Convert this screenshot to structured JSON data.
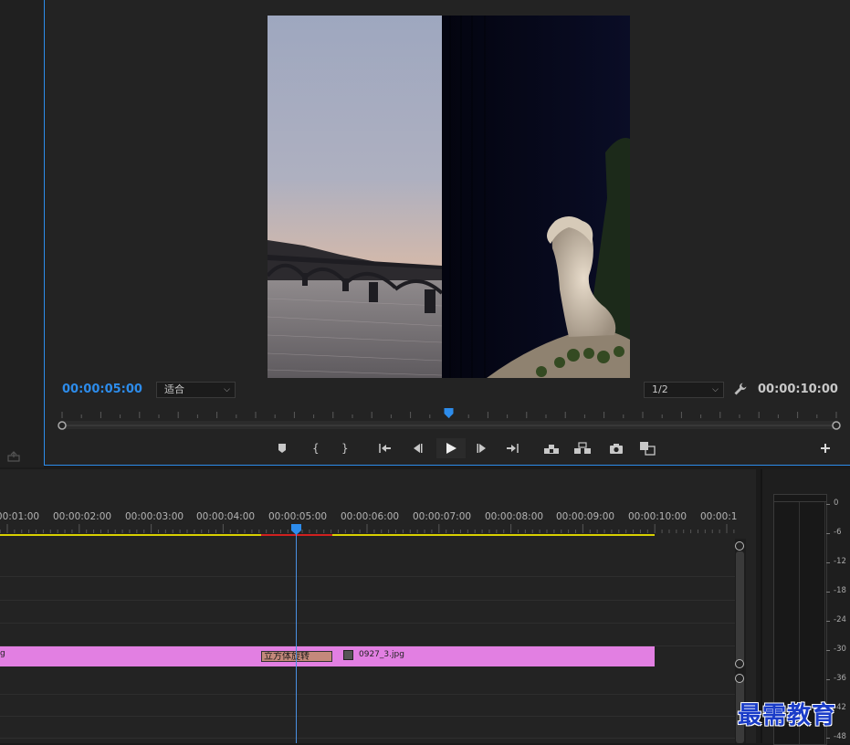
{
  "monitor": {
    "current_timecode": "00:00:05:00",
    "duration_timecode": "00:00:10:00",
    "zoom_select": "适合",
    "resolution_select": "1/2",
    "playhead_fraction": 0.5
  },
  "transport": {
    "buttons": [
      "add-marker",
      "mark-in",
      "mark-out",
      "go-to-in",
      "step-back",
      "play",
      "step-forward",
      "go-to-out",
      "lift",
      "extract",
      "export-frame",
      "comparison-view"
    ]
  },
  "timeline": {
    "ruler_labels": [
      "00:00:01:00",
      "00:00:02:00",
      "00:00:03:00",
      "00:00:04:00",
      "00:00:05:00",
      "00:00:06:00",
      "00:00:07:00",
      "00:00:08:00",
      "00:00:09:00",
      "00:00:10:00",
      "00:00:1"
    ],
    "clip_left_label": "g",
    "transition_label": "立方体旋转",
    "clip_name": "0927_3.jpg",
    "work_area_color": "#d8d000",
    "clip_color": "#e27fe2"
  },
  "audio_meter": {
    "db_labels": [
      "0",
      "-6",
      "-12",
      "-18",
      "-24",
      "-30",
      "-36",
      "-42",
      "-48"
    ]
  },
  "watermark": "最需教育",
  "colors": {
    "accent": "#2d8ceb"
  }
}
